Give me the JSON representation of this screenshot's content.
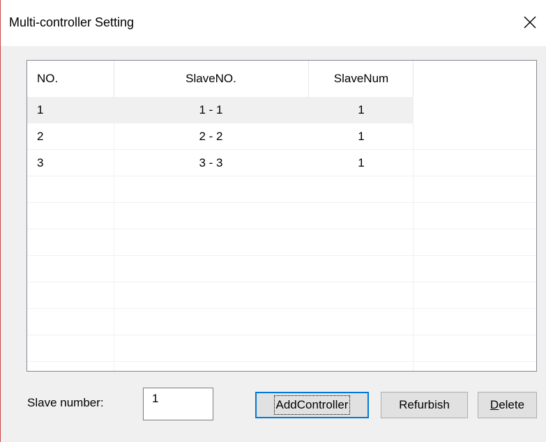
{
  "window": {
    "title": "Multi-controller Setting"
  },
  "table": {
    "headers": [
      "NO.",
      "SlaveNO.",
      "SlaveNum"
    ],
    "rows": [
      {
        "no": "1",
        "slave_no": "1 - 1",
        "slave_num": "1",
        "selected": true
      },
      {
        "no": "2",
        "slave_no": "2 - 2",
        "slave_num": "1",
        "selected": false
      },
      {
        "no": "3",
        "slave_no": "3 - 3",
        "slave_num": "1",
        "selected": false
      }
    ]
  },
  "form": {
    "slave_number_label": "Slave number:",
    "slave_number_value": "1"
  },
  "buttons": {
    "add_controller": "AddController",
    "refurbish": "Refurbish",
    "delete": "Delete"
  },
  "colors": {
    "accent": "#0078d7",
    "selected_row": "#f0f0f0"
  }
}
